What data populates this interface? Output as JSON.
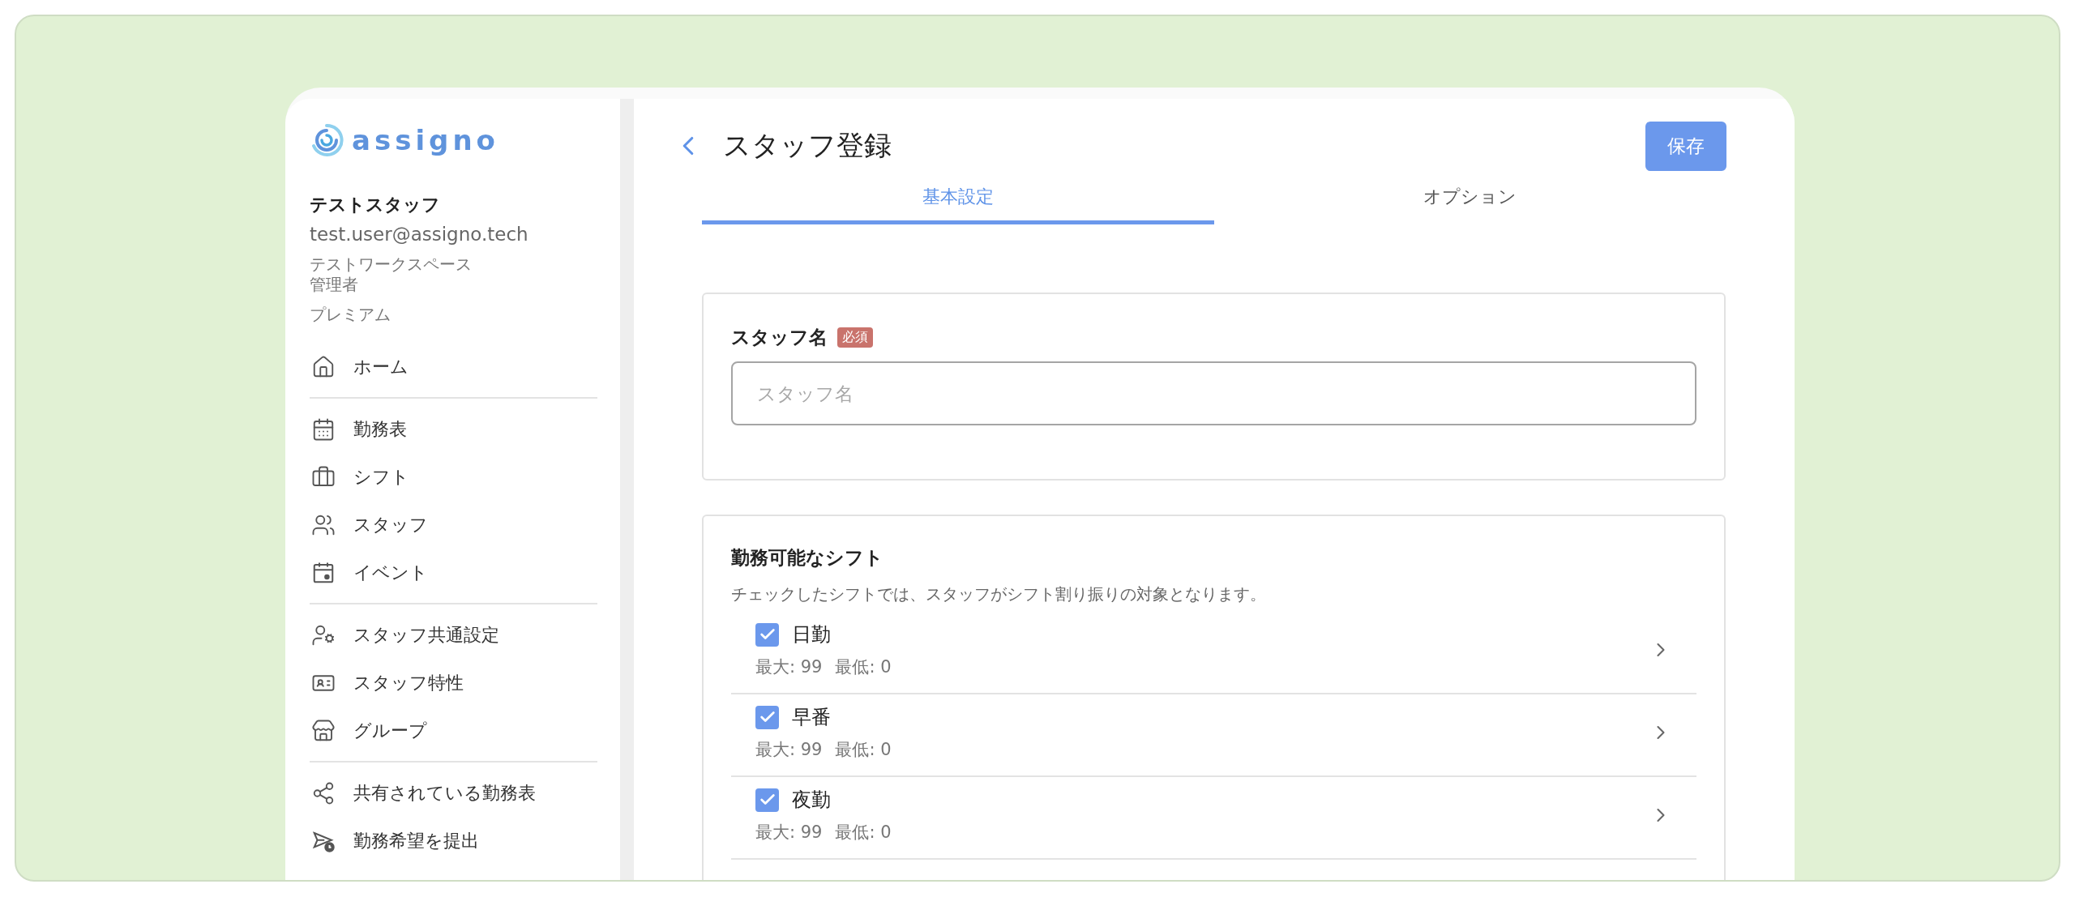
{
  "logo": {
    "text": "assigno"
  },
  "user": {
    "name": "テストスタッフ",
    "email": "test.user@assigno.tech",
    "workspace": "テストワークスペース",
    "role": "管理者",
    "plan": "プレミアム"
  },
  "nav_sections": [
    {
      "items": [
        {
          "label": "ホーム"
        }
      ]
    },
    {
      "items": [
        {
          "label": "勤務表"
        },
        {
          "label": "シフト"
        },
        {
          "label": "スタッフ"
        },
        {
          "label": "イベント"
        }
      ]
    },
    {
      "items": [
        {
          "label": "スタッフ共通設定"
        },
        {
          "label": "スタッフ特性"
        },
        {
          "label": "グループ"
        }
      ]
    },
    {
      "items": [
        {
          "label": "共有されている勤務表"
        },
        {
          "label": "勤務希望を提出"
        }
      ]
    }
  ],
  "header": {
    "title": "スタッフ登録",
    "save_button": "保存"
  },
  "tabs": [
    {
      "label": "基本設定",
      "selected": true
    },
    {
      "label": "オプション",
      "selected": false
    }
  ],
  "name_card": {
    "label": "スタッフ名",
    "badge": "必須",
    "placeholder": "スタッフ名"
  },
  "shifts_card": {
    "title": "勤務可能なシフト",
    "description": "チェックしたシフトでは、スタッフがシフト割り振りの対象となります。",
    "shifts": [
      {
        "name": "日勤",
        "checked": true,
        "max": "最大: 99",
        "min": "最低: 0"
      },
      {
        "name": "早番",
        "checked": true,
        "max": "最大: 99",
        "min": "最低: 0"
      },
      {
        "name": "夜勤",
        "checked": true,
        "max": "最大: 99",
        "min": "最低: 0"
      }
    ]
  }
}
